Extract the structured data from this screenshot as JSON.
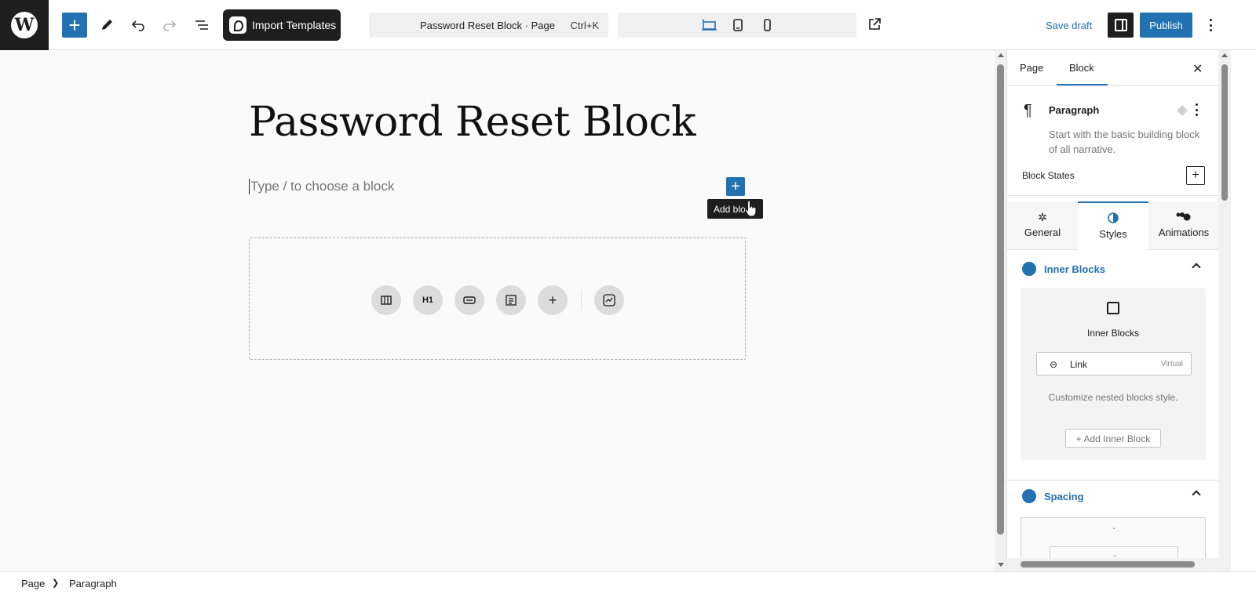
{
  "topbar": {
    "import_label": "Import Templates",
    "command_title": "Password Reset Block · Page",
    "command_shortcut": "Ctrl+K",
    "save_draft_label": "Save draft",
    "publish_label": "Publish",
    "accent_color": "#2271b1"
  },
  "editor": {
    "page_title": "Password Reset Block",
    "placeholder": "Type / to choose a block",
    "inline_add_tooltip": "Add block",
    "inline_add_tooltip_visible": "Add blo",
    "quick_blocks": [
      {
        "icon": "columns-icon",
        "label": ""
      },
      {
        "icon": "heading-icon",
        "label": "H1"
      },
      {
        "icon": "button-icon",
        "label": ""
      },
      {
        "icon": "form-icon",
        "label": ""
      },
      {
        "icon": "plus-icon",
        "label": ""
      },
      {
        "icon": "chart-icon",
        "label": ""
      }
    ]
  },
  "sidebar": {
    "tabs": [
      {
        "label": "Page"
      },
      {
        "label": "Block"
      }
    ],
    "active_tab": "Block",
    "block": {
      "name": "Paragraph",
      "description": "Start with the basic building block of all narrative."
    },
    "block_states_label": "Block States",
    "subtabs": [
      {
        "label": "General"
      },
      {
        "label": "Styles"
      },
      {
        "label": "Animations"
      }
    ],
    "active_subtab": "Styles",
    "inner_blocks": {
      "section_title": "Inner Blocks",
      "panel_title": "Inner Blocks",
      "link_label": "Link",
      "link_badge": "Virtual",
      "description": "Customize nested blocks style.",
      "add_label": "+ Add Inner Block"
    },
    "spacing": {
      "section_title": "Spacing",
      "outer_value": "-",
      "inner_value": "-"
    }
  },
  "footer": {
    "breadcrumb": [
      {
        "label": "Page"
      },
      {
        "label": "Paragraph"
      }
    ]
  }
}
